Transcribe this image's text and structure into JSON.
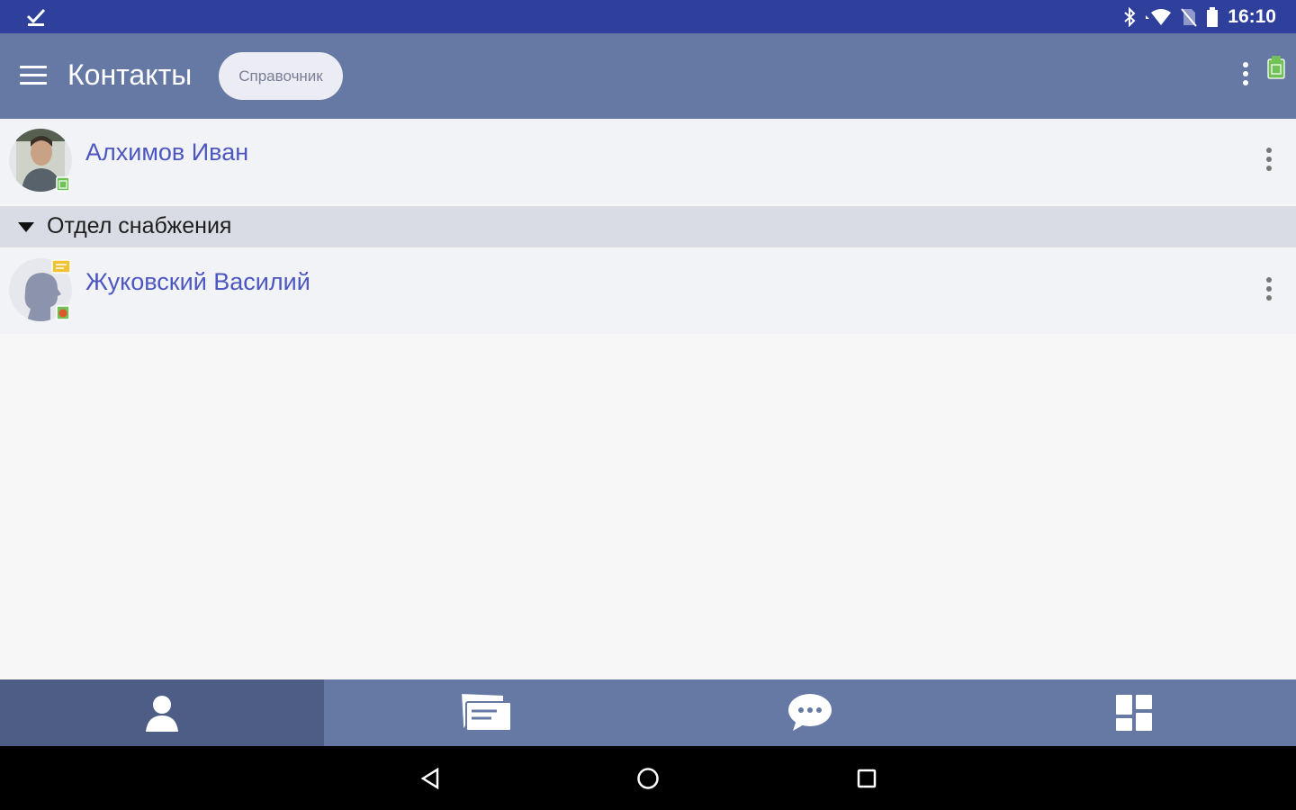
{
  "status_bar": {
    "time": "16:10",
    "icons": [
      "check-icon",
      "bluetooth-icon",
      "wifi-icon",
      "no-sim-icon",
      "battery-icon"
    ]
  },
  "app_bar": {
    "menu_icon": "menu-icon",
    "title": "Контакты",
    "chip_label": "Справочник",
    "more_icon": "more-vertical-icon",
    "status_icon": "presence-available-icon"
  },
  "contacts": [
    {
      "name": "Алхимов Иван",
      "avatar": "photo",
      "status": "available",
      "more_icon": "more-vertical-icon"
    }
  ],
  "group": {
    "label": "Отдел снабжения",
    "expanded": true,
    "contacts": [
      {
        "name": "Жуковский Василий",
        "avatar": "placeholder",
        "status": "busy",
        "has_message_badge": true,
        "more_icon": "more-vertical-icon"
      }
    ]
  },
  "bottom_nav": {
    "active_index": 0,
    "items": [
      {
        "icon": "contacts-icon"
      },
      {
        "icon": "messages-icon"
      },
      {
        "icon": "chat-icon"
      },
      {
        "icon": "apps-icon"
      }
    ]
  },
  "system_nav": [
    "back-icon",
    "home-icon",
    "recents-icon"
  ],
  "colors": {
    "status_bar": "#2e3f9c",
    "app_bar": "#6679a4",
    "active_tab": "#4d5d86",
    "contact_name": "#4c57bf",
    "group_bg": "#d9dce4",
    "presence_available": "#6fc158",
    "presence_busy": "#e0572f",
    "message_badge": "#f1c232"
  }
}
